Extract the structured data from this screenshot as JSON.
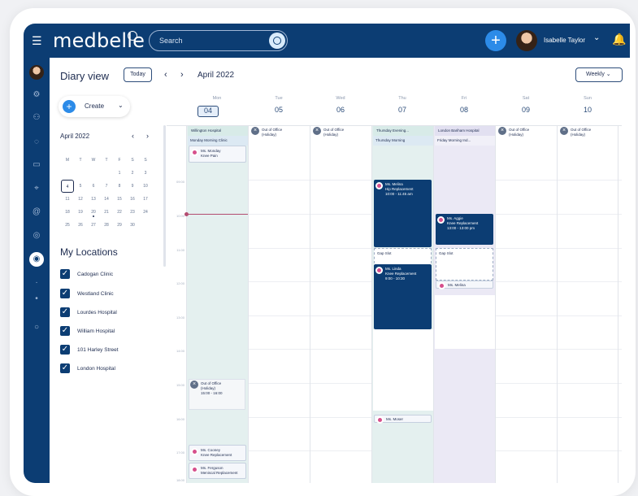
{
  "app": {
    "brand": "medbelle",
    "search_placeholder": "Search",
    "user_name": "Isabelle Taylor"
  },
  "toolbar": {
    "title": "Diary view",
    "today": "Today",
    "month": "April 2022",
    "view": "Weekly",
    "create": "Create"
  },
  "mini_calendar": {
    "month": "April 2022",
    "weekday_initials": [
      "M",
      "T",
      "W",
      "T",
      "F",
      "S",
      "S"
    ],
    "rows": [
      [
        "",
        "",
        "",
        "",
        "1",
        "2",
        "3"
      ],
      [
        "4",
        "5",
        "6",
        "7",
        "8",
        "9",
        "10"
      ],
      [
        "11",
        "12",
        "13",
        "14",
        "15",
        "16",
        "17"
      ],
      [
        "18",
        "19",
        "20",
        "21",
        "22",
        "23",
        "24"
      ],
      [
        "25",
        "26",
        "27",
        "28",
        "29",
        "30",
        ""
      ]
    ]
  },
  "locations": {
    "title": "My Locations",
    "items": [
      "Cadogan Clinic",
      "Westland Clinic",
      "Lourdes Hospital",
      "William Hospital",
      "101 Harley Street",
      "London Hospital"
    ]
  },
  "calendar": {
    "days": [
      {
        "name": "Mon",
        "num": "04"
      },
      {
        "name": "Tue",
        "num": "05"
      },
      {
        "name": "Wed",
        "num": "06"
      },
      {
        "name": "Thu",
        "num": "07"
      },
      {
        "name": "Fri",
        "num": "08"
      },
      {
        "name": "Sat",
        "num": "09"
      },
      {
        "name": "Sun",
        "num": "10"
      }
    ],
    "hours": [
      "09:00",
      "10:00",
      "11:00",
      "12:00",
      "13:00",
      "14:00",
      "15:00",
      "16:00",
      "17:00",
      "18:00"
    ],
    "mon": {
      "location": "Willington Hospital",
      "session": "Monday Morning Clinic",
      "event1_name": "Ms. Monday",
      "event1_detail": "Knee Pain",
      "ooo_title": "Out of Office",
      "ooo_detail": "(Holiday)",
      "ooo_time": "15:00 - 16:00",
      "event2_name": "Ms. Cooney",
      "event2_detail": "Knee Replacement",
      "event3_name": "Ms. Ferguson",
      "event3_detail": "Meniscal Replacement"
    },
    "tue": {
      "ooo_title": "Out of Office",
      "ooo_detail": "(Holiday)"
    },
    "wed": {
      "ooo_title": "Out of Office",
      "ooo_detail": "(Holiday)"
    },
    "thu": {
      "location": "Thursday Evening...",
      "session": "Thursday Morning",
      "event1_name": "Ms. Melina",
      "event1_detail": "Hip Replacement",
      "event1_time": "10:00 - 11:45 am",
      "gap": "Gap Slot",
      "event2_name": "Ms. Linda",
      "event2_detail": "Knee Replacement",
      "event2_time": "9:00 - 10:30",
      "event3_name": "Ms. Moser"
    },
    "fri": {
      "location": "London Bariham Hospital",
      "session": "Friday Morning Ind...",
      "event1_name": "Ms. Aggie",
      "event1_detail": "Knee Replacement",
      "event1_time": "13:00 - 13:00 pm",
      "gap": "Gap Slot",
      "event2_name": "Ms. Melina"
    },
    "sat": {
      "ooo_title": "Out of Office",
      "ooo_detail": "(Holiday)"
    },
    "sun": {
      "ooo_title": "Out of Office",
      "ooo_detail": "(Holiday)"
    }
  },
  "colors": {
    "navy": "#0c3d73",
    "accent_blue": "#2c8be8",
    "teal_tint": "#e4f0ef",
    "lavender_tint": "#ebe9f5",
    "patient_badge": "#d64f8c"
  },
  "icons": [
    "menu-icon",
    "search-icon",
    "plus-icon",
    "chevron-down-icon",
    "bell-icon",
    "settings-icon",
    "team-icon",
    "check-icon",
    "message-icon",
    "calendar-icon",
    "map-icon",
    "close-icon"
  ]
}
